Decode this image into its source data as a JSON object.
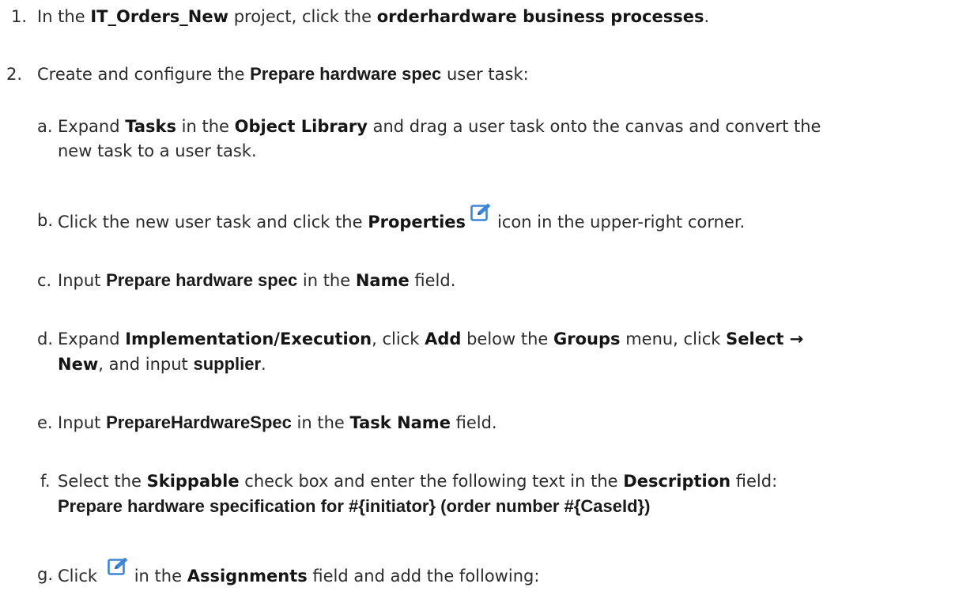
{
  "steps": [
    {
      "number": "1.",
      "parts": [
        "In the ",
        "IT_Orders_New",
        " project, click the ",
        "orderhardware business processes",
        "."
      ]
    },
    {
      "number": "2.",
      "parts": [
        "Create and configure the ",
        "Prepare hardware spec",
        " user task:"
      ],
      "substeps": {
        "a": {
          "letter": "a.",
          "line1": [
            "Expand ",
            "Tasks",
            " in the ",
            "Object Library",
            " and drag a user task onto the canvas and convert the"
          ],
          "line2": "new task to a user task."
        },
        "b": {
          "letter": "b.",
          "parts": [
            "Click the new user task and click the ",
            "Properties",
            "icon in the upper-right corner."
          ]
        },
        "c": {
          "letter": "c.",
          "parts": [
            "Input ",
            "Prepare hardware spec",
            " in the ",
            "Name",
            " field."
          ]
        },
        "d": {
          "letter": "d.",
          "line1": [
            "Expand ",
            "Implementation/Execution",
            ", click ",
            "Add",
            " below the ",
            "Groups",
            " menu, click ",
            "Select →"
          ],
          "line2": [
            "New",
            ", and input ",
            "supplier",
            "."
          ]
        },
        "e": {
          "letter": "e.",
          "parts": [
            "Input ",
            "PrepareHardwareSpec",
            " in the ",
            "Task Name",
            " field."
          ]
        },
        "f": {
          "letter": "f.",
          "line1": [
            "Select the ",
            "Skippable",
            " check box and enter the following text in the ",
            "Description",
            " field:"
          ],
          "line2": "Prepare hardware specification for #{initiator} (order number #{CaseId})"
        },
        "g": {
          "letter": "g.",
          "parts": [
            "Click ",
            "in the ",
            "Assignments",
            " field and add the following:"
          ]
        }
      }
    }
  ],
  "icons": {
    "edit": "edit-pencil-icon",
    "edit_color": "#3b86d8"
  }
}
